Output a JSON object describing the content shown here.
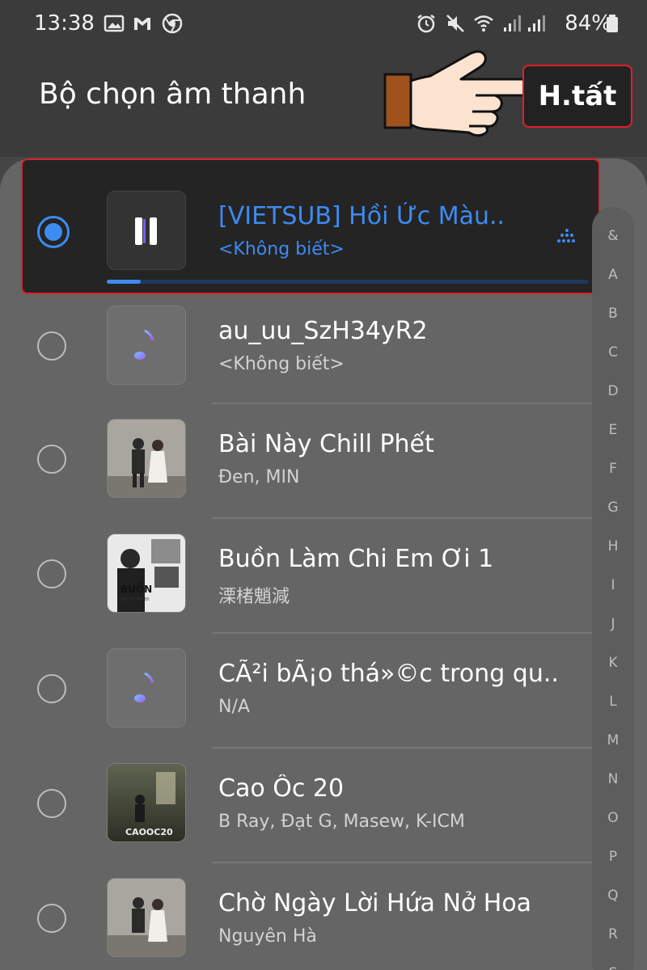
{
  "status": {
    "time": "13:38",
    "battery": "84%",
    "icons": [
      "gallery-icon",
      "gmail-icon",
      "chrome-icon",
      "alarm-icon",
      "mute-icon",
      "wifi-icon",
      "signal-icon",
      "signal-icon",
      "battery-icon"
    ]
  },
  "header": {
    "title": "Bộ chọn âm thanh",
    "done_label": "H.tất"
  },
  "selected": {
    "song": "[VIETSUB] Hồi Ức Màu..",
    "artist": "<Không biết>",
    "progress": 0.07,
    "accent": "#3d8bf2"
  },
  "songs": [
    {
      "song": "au_uu_SzH34yR2",
      "artist": "<Không biết>",
      "thumb": "music-note-icon"
    },
    {
      "song": "Bài Này Chill Phết",
      "artist": "Đen, MIN",
      "thumb": "album-art"
    },
    {
      "song": "Buồn Làm Chi Em Ơi 1",
      "artist": "溧楮魈減",
      "thumb": "album-art"
    },
    {
      "song": "CÃ²i bÃ¡o thá»©c trong qu..",
      "artist": "N/A",
      "thumb": "music-note-icon"
    },
    {
      "song": "Cao Ốc 20",
      "artist": "B Ray, Đạt G, Masew, K-ICM",
      "thumb": "album-art"
    },
    {
      "song": "Chờ Ngày Lời Hứa Nở Hoa",
      "artist": "Nguyên Hà",
      "thumb": "album-art"
    }
  ],
  "alpha_index": [
    "&",
    "A",
    "B",
    "C",
    "D",
    "E",
    "F",
    "G",
    "H",
    "I",
    "J",
    "K",
    "L",
    "M",
    "N",
    "O",
    "P",
    "Q",
    "R",
    "S"
  ],
  "thumb_labels": {
    "buon": "BUỒN",
    "buon_sub": "LÀM CHI EM ƠI",
    "cao": "CAOOC20"
  }
}
